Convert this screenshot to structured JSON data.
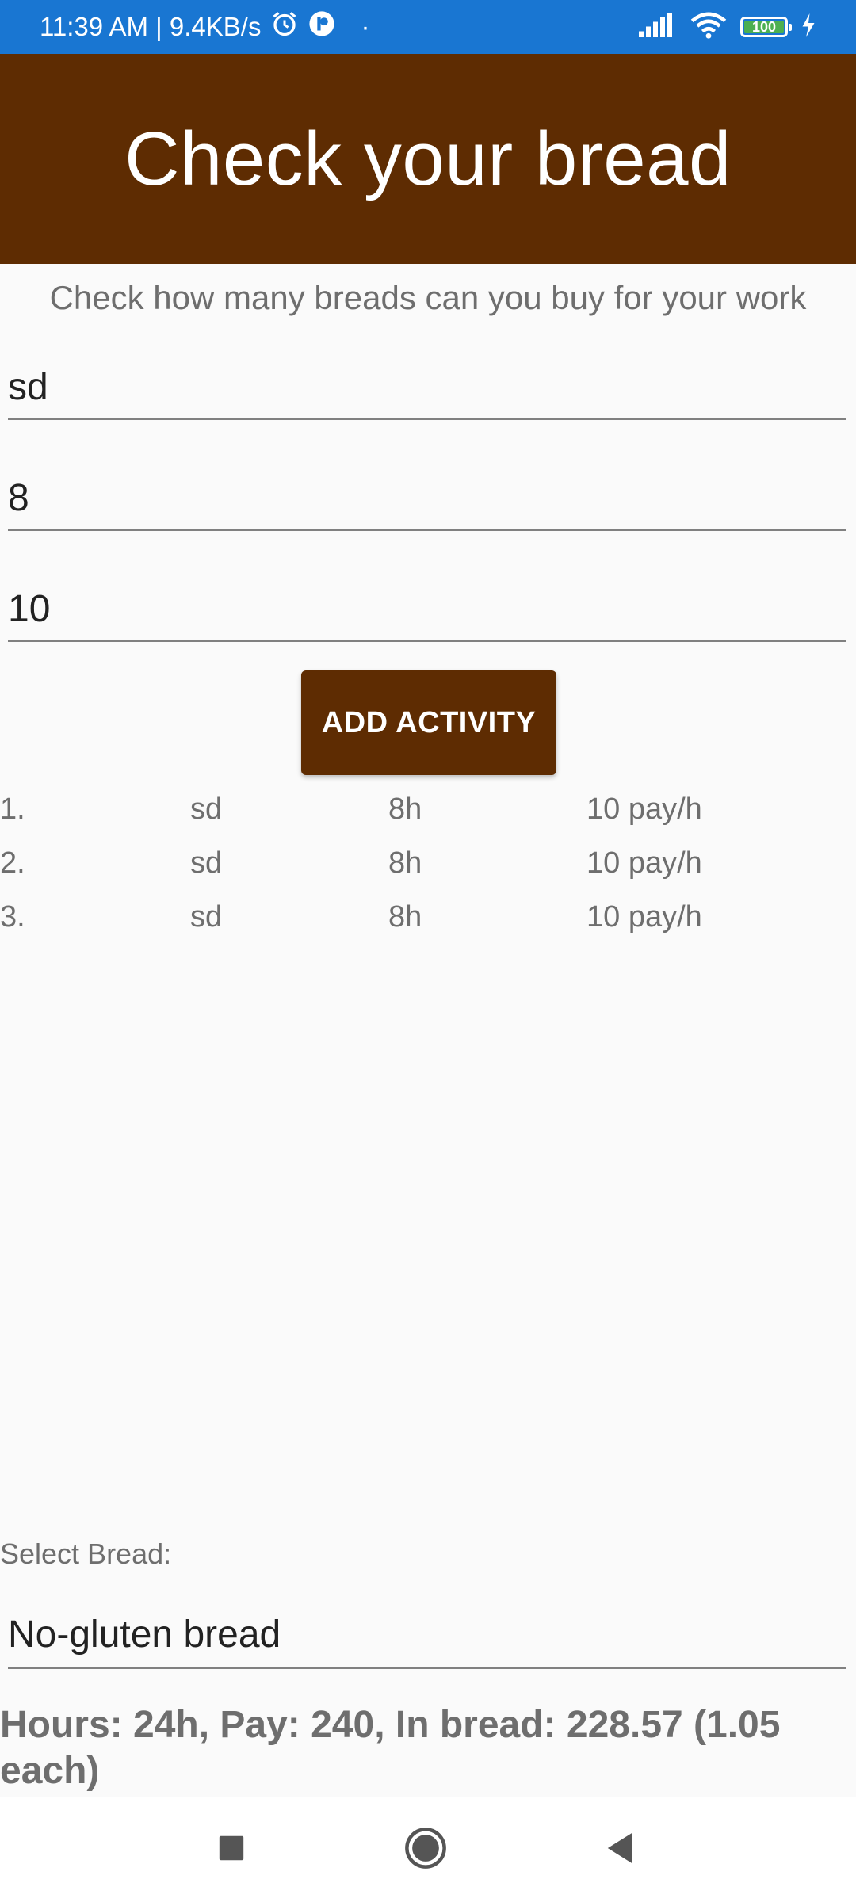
{
  "status_bar": {
    "time_speed": "11:39 AM | 9.4KB/s",
    "dot": "·",
    "battery": "100",
    "colors": {
      "background": "#1976d2",
      "battery_fill": "#4caf50"
    }
  },
  "header": {
    "title": "Check your bread",
    "color": "#5e2c02"
  },
  "subtitle": "Check how many breads can you buy for your work",
  "inputs": {
    "activity_name": "sd",
    "hours": "8",
    "pay_per_hour": "10"
  },
  "add_button_label": "ADD ACTIVITY",
  "activities": [
    {
      "index": "1.",
      "name": "sd",
      "hours": "8h",
      "pay": "10 pay/h"
    },
    {
      "index": "2.",
      "name": "sd",
      "hours": "8h",
      "pay": "10 pay/h"
    },
    {
      "index": "3.",
      "name": "sd",
      "hours": "8h",
      "pay": "10 pay/h"
    }
  ],
  "bread_select": {
    "label": "Select Bread:",
    "selected": "No-gluten bread"
  },
  "summary": "Hours: 24h, Pay: 240, In bread: 228.57 (1.05 each)",
  "icons": {
    "status_left": [
      "alarm-icon",
      "notification-app-icon"
    ],
    "status_right": [
      "signal-icon",
      "wifi-icon",
      "battery-icon",
      "charging-icon"
    ],
    "nav": [
      "recents-icon",
      "home-icon",
      "back-icon"
    ]
  }
}
